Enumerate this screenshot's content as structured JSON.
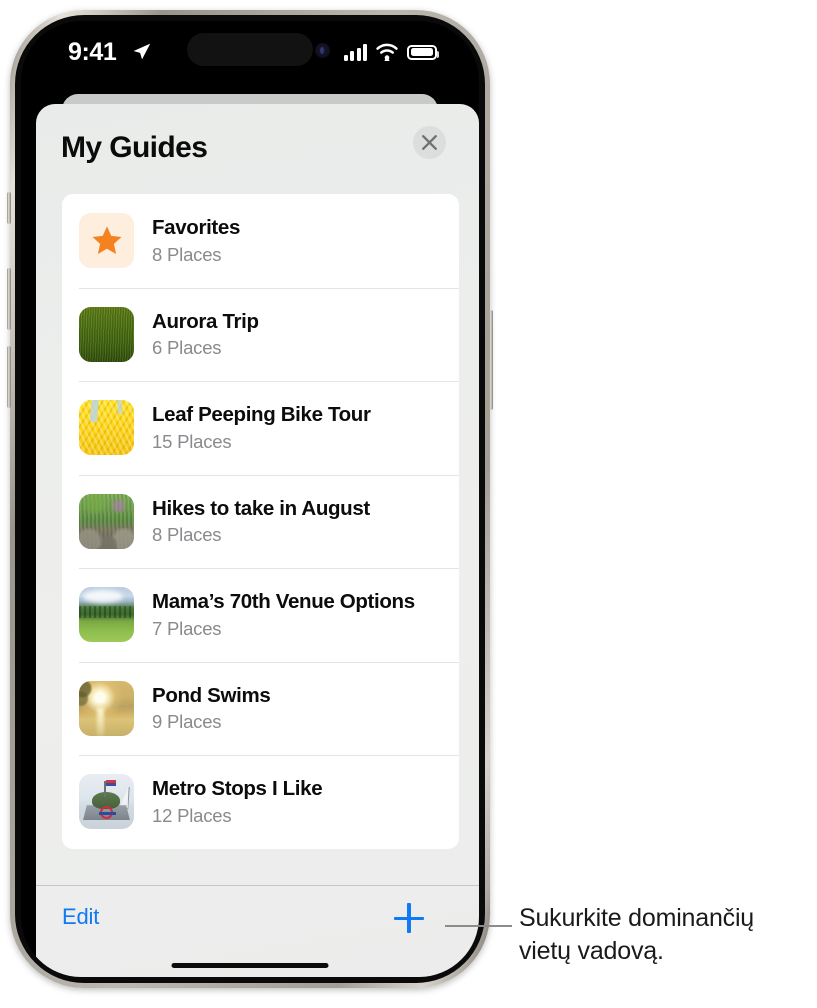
{
  "status_bar": {
    "time": "9:41",
    "location_icon": "location-arrow-icon",
    "signal_icon": "cellular-signal-icon",
    "wifi_icon": "wifi-icon",
    "battery_icon": "battery-full-icon"
  },
  "sheet": {
    "title": "My Guides",
    "close_icon": "close-icon"
  },
  "guides": [
    {
      "title": "Favorites",
      "places": "8 Places",
      "thumb": "favorites-star-thumbnail"
    },
    {
      "title": "Aurora Trip",
      "places": "6 Places",
      "thumb": "green-field-thumbnail"
    },
    {
      "title": "Leaf Peeping Bike Tour",
      "places": "15 Places",
      "thumb": "yellow-autumn-leaves-thumbnail"
    },
    {
      "title": "Hikes to take in August",
      "places": "8 Places",
      "thumb": "forest-trail-thumbnail"
    },
    {
      "title": "Mama’s 70th Venue Options",
      "places": "7 Places",
      "thumb": "meadow-clouds-thumbnail"
    },
    {
      "title": "Pond Swims",
      "places": "9 Places",
      "thumb": "sunset-lake-thumbnail"
    },
    {
      "title": "Metro Stops I Like",
      "places": "12 Places",
      "thumb": "monument-harbor-thumbnail"
    }
  ],
  "toolbar": {
    "edit_label": "Edit",
    "add_icon": "plus-icon"
  },
  "callout": {
    "text": "Sukurkite dominančių vietų vadovą."
  },
  "colors": {
    "accent_blue": "#1079f5",
    "star_orange": "#f58220",
    "star_bg": "#fdeedd",
    "sheet_bg": "#ececea",
    "card_bg": "#ffffff",
    "subtitle_gray": "#8a8a8e",
    "divider": "#e4e4e4",
    "callout_line": "#8c8c8c"
  }
}
